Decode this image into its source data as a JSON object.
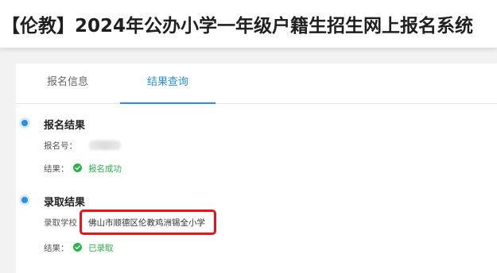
{
  "header": {
    "title": "【伦教】2024年公办小学一年级户籍生招生网上报名系统"
  },
  "tabs": [
    {
      "label": "报名信息",
      "active": false
    },
    {
      "label": "结果查询",
      "active": true
    }
  ],
  "registration": {
    "title": "报名结果",
    "number_label": "报名号：",
    "result_label": "结果：",
    "result_value": "报名成功"
  },
  "admission": {
    "title": "录取结果",
    "school_label": "录取学校",
    "school_value": "佛山市顺德区伦教鸡洲锡全小学",
    "result_label": "结果：",
    "result_value": "已录取"
  },
  "colors": {
    "accent": "#2b8fe8",
    "success": "#2bb24c",
    "highlight": "#e8131b"
  },
  "icons": {
    "dot": "timeline-dot-icon",
    "check": "check-circle-icon"
  }
}
